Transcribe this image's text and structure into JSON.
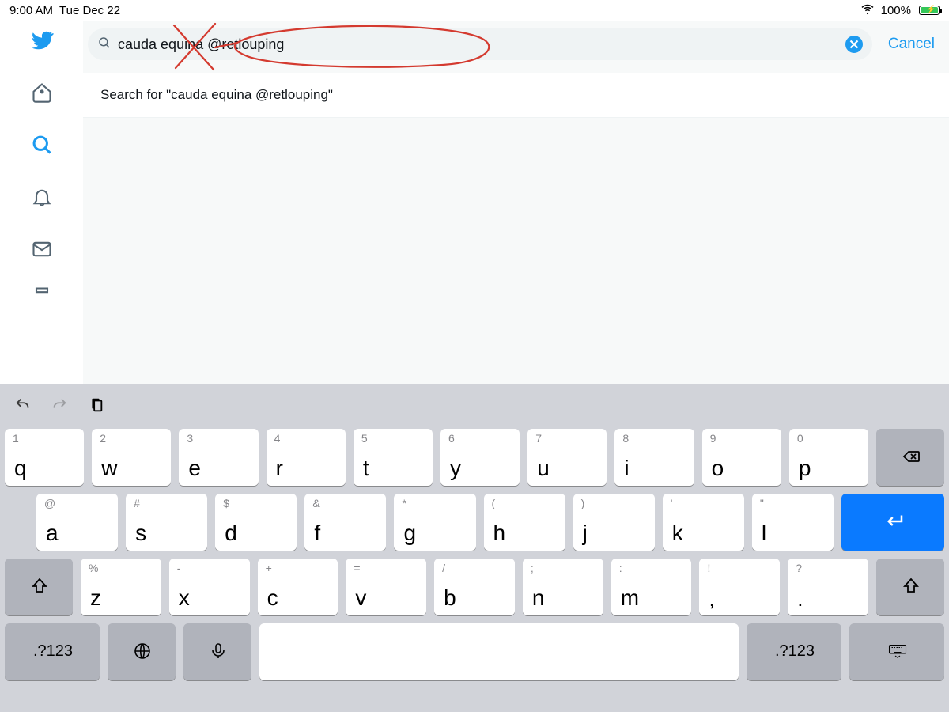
{
  "status": {
    "time": "9:00 AM",
    "date": "Tue Dec 22",
    "battery_pct": "100%"
  },
  "sidebar": {
    "icons": [
      "logo",
      "home",
      "search",
      "notifications",
      "messages",
      "bookmarks"
    ]
  },
  "search": {
    "query": "cauda equina @retlouping",
    "cancel": "Cancel",
    "suggestion": "Search for \"cauda equina @retlouping\""
  },
  "keyboard": {
    "row1": [
      {
        "hint": "1",
        "main": "q"
      },
      {
        "hint": "2",
        "main": "w"
      },
      {
        "hint": "3",
        "main": "e"
      },
      {
        "hint": "4",
        "main": "r"
      },
      {
        "hint": "5",
        "main": "t"
      },
      {
        "hint": "6",
        "main": "y"
      },
      {
        "hint": "7",
        "main": "u"
      },
      {
        "hint": "8",
        "main": "i"
      },
      {
        "hint": "9",
        "main": "o"
      },
      {
        "hint": "0",
        "main": "p"
      }
    ],
    "row2": [
      {
        "hint": "@",
        "main": "a"
      },
      {
        "hint": "#",
        "main": "s"
      },
      {
        "hint": "$",
        "main": "d"
      },
      {
        "hint": "&",
        "main": "f"
      },
      {
        "hint": "*",
        "main": "g"
      },
      {
        "hint": "(",
        "main": "h"
      },
      {
        "hint": ")",
        "main": "j"
      },
      {
        "hint": "'",
        "main": "k"
      },
      {
        "hint": "\"",
        "main": "l"
      }
    ],
    "row3": [
      {
        "hint": "%",
        "main": "z"
      },
      {
        "hint": "-",
        "main": "x"
      },
      {
        "hint": "+",
        "main": "c"
      },
      {
        "hint": "=",
        "main": "v"
      },
      {
        "hint": "/",
        "main": "b"
      },
      {
        "hint": ";",
        "main": "n"
      },
      {
        "hint": ":",
        "main": "m"
      },
      {
        "hint": "!",
        "main": ","
      },
      {
        "hint": "?",
        "main": "."
      }
    ],
    "numkey": ".?123"
  }
}
